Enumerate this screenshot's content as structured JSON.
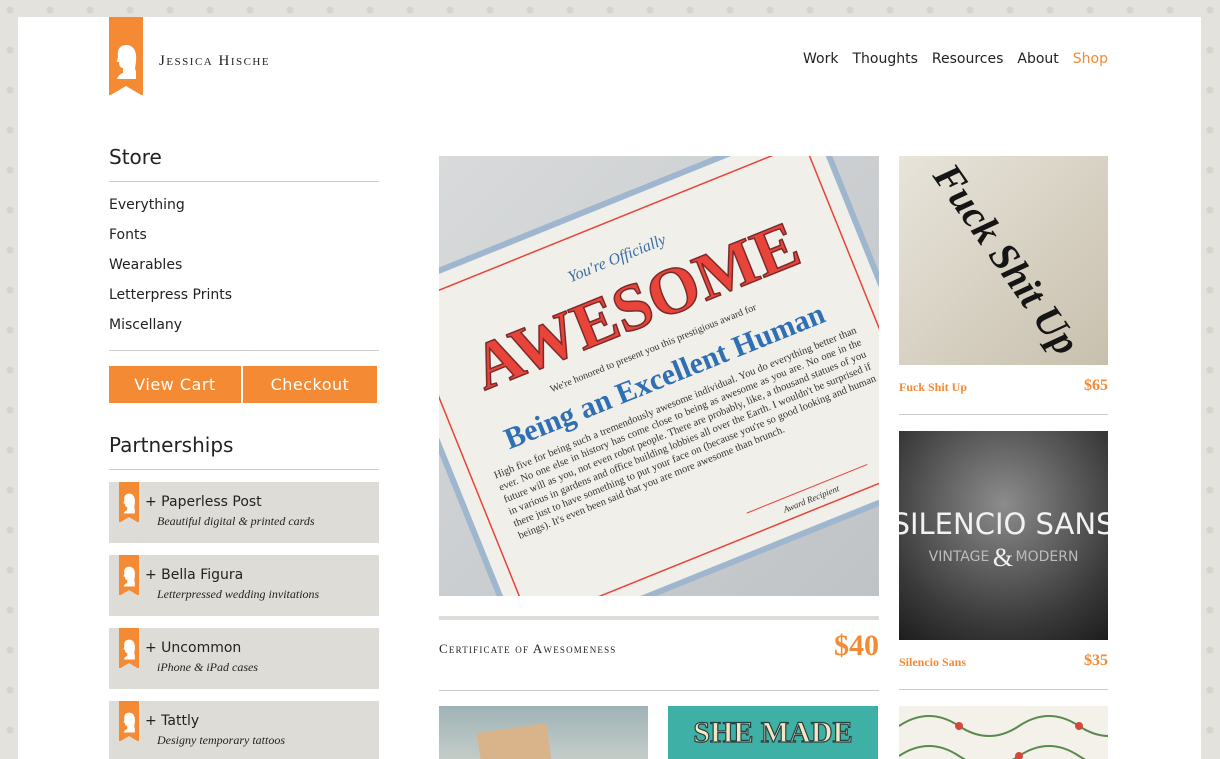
{
  "header": {
    "brand": "Jessica Hische",
    "nav": [
      {
        "label": "Work",
        "active": false
      },
      {
        "label": "Thoughts",
        "active": false
      },
      {
        "label": "Resources",
        "active": false
      },
      {
        "label": "About",
        "active": false
      },
      {
        "label": "Shop",
        "active": true
      }
    ]
  },
  "sidebar": {
    "store_title": "Store",
    "store_items": [
      "Everything",
      "Fonts",
      "Wearables",
      "Letterpress Prints",
      "Miscellany"
    ],
    "view_cart": "View Cart",
    "checkout": "Checkout",
    "partnerships_title": "Partnerships",
    "partners": [
      {
        "name": "+ Paperless Post",
        "desc": "Beautiful digital & printed cards"
      },
      {
        "name": "+ Bella Figura",
        "desc": "Letterpressed wedding invitations"
      },
      {
        "name": "+ Uncommon",
        "desc": "iPhone & iPad cases"
      },
      {
        "name": "+ Tattly",
        "desc": "Designy temporary tattoos"
      }
    ]
  },
  "featured": {
    "title": "Certificate of Awesomeness",
    "price": "$40",
    "art": {
      "line1": "You're Officially",
      "line2": "AWESOME",
      "line3": "We're honored to present you this prestigious award for",
      "line4": "Being an Excellent Human",
      "body": "High five for being such a tremendously awesome individual. You do everything better than ever. No one else in history has come close to being as awesome as you are. No one in the future will as you, not even robot people. There are probably, like, a thousand statues of you in various in gardens and office building lobbies all over the Earth. I wouldn't be surprised if there just to have something to put your face on (because you're so good looking and human beings). It's even been said that you are more awesome than brunch.",
      "footer": "Award Recipient"
    }
  },
  "products": [
    {
      "name": "Fuck Shit Up",
      "price": "$65",
      "art_text": "Fuck Shit Up"
    },
    {
      "name": "Silencio Sans",
      "price": "$35",
      "art_title": "SILENCIO SANS",
      "art_sub_left": "VINTAGE",
      "art_amp": "&",
      "art_sub_right": "MODERN"
    }
  ],
  "bottom_row": [
    {
      "art_text": ""
    },
    {
      "art_text": "SHE MADE"
    },
    {
      "art_text": ""
    }
  ],
  "colors": {
    "accent": "#f48a33",
    "panel": "#dddcd7",
    "background": "#e4e2dc"
  }
}
